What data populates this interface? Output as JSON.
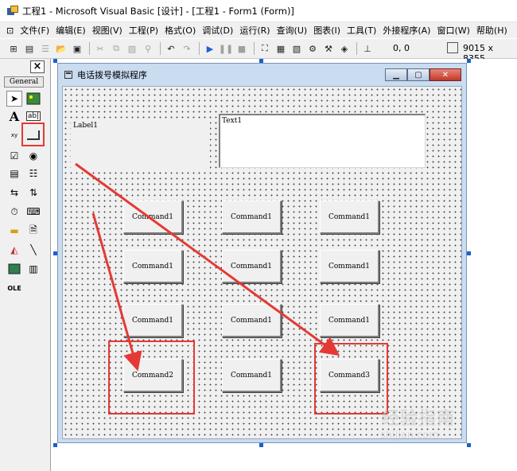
{
  "window": {
    "title": "工程1 - Microsoft Visual Basic [设计] - [工程1 - Form1 (Form)]"
  },
  "menu": [
    "文件(F)",
    "编辑(E)",
    "视图(V)",
    "工程(P)",
    "格式(O)",
    "调试(D)",
    "运行(R)",
    "查询(U)",
    "图表(I)",
    "工具(T)",
    "外接程序(A)",
    "窗口(W)",
    "帮助(H)"
  ],
  "toolbar": {
    "position": "0, 0",
    "size": "9015 x 8355"
  },
  "toolbox": {
    "tab": "General",
    "close_label": "×"
  },
  "form": {
    "title": "电话拨号模拟程序",
    "label": "Label1",
    "textbox": "Text1",
    "buttons": [
      [
        "Command1",
        "Command1",
        "Command1"
      ],
      [
        "Command1",
        "Command1",
        "Command1"
      ],
      [
        "Command1",
        "Command1",
        "Command1"
      ],
      [
        "Command2",
        "Command1",
        "Command3"
      ]
    ]
  },
  "watermark": {
    "line1": "经验指南",
    "line2": "shijian.com"
  },
  "colors": {
    "annotation": "#e53935",
    "form_title": "#c9dcf0",
    "selection_handle": "#1c5fd0"
  }
}
